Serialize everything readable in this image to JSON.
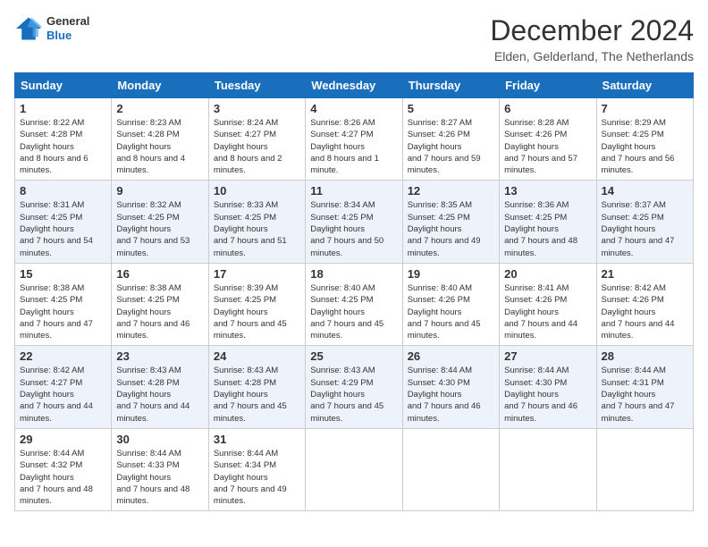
{
  "header": {
    "logo_general": "General",
    "logo_blue": "Blue",
    "title": "December 2024",
    "location": "Elden, Gelderland, The Netherlands"
  },
  "weekdays": [
    "Sunday",
    "Monday",
    "Tuesday",
    "Wednesday",
    "Thursday",
    "Friday",
    "Saturday"
  ],
  "weeks": [
    [
      {
        "day": "1",
        "sunrise": "8:22 AM",
        "sunset": "4:28 PM",
        "daylight": "8 hours and 6 minutes."
      },
      {
        "day": "2",
        "sunrise": "8:23 AM",
        "sunset": "4:28 PM",
        "daylight": "8 hours and 4 minutes."
      },
      {
        "day": "3",
        "sunrise": "8:24 AM",
        "sunset": "4:27 PM",
        "daylight": "8 hours and 2 minutes."
      },
      {
        "day": "4",
        "sunrise": "8:26 AM",
        "sunset": "4:27 PM",
        "daylight": "8 hours and 1 minute."
      },
      {
        "day": "5",
        "sunrise": "8:27 AM",
        "sunset": "4:26 PM",
        "daylight": "7 hours and 59 minutes."
      },
      {
        "day": "6",
        "sunrise": "8:28 AM",
        "sunset": "4:26 PM",
        "daylight": "7 hours and 57 minutes."
      },
      {
        "day": "7",
        "sunrise": "8:29 AM",
        "sunset": "4:25 PM",
        "daylight": "7 hours and 56 minutes."
      }
    ],
    [
      {
        "day": "8",
        "sunrise": "8:31 AM",
        "sunset": "4:25 PM",
        "daylight": "7 hours and 54 minutes."
      },
      {
        "day": "9",
        "sunrise": "8:32 AM",
        "sunset": "4:25 PM",
        "daylight": "7 hours and 53 minutes."
      },
      {
        "day": "10",
        "sunrise": "8:33 AM",
        "sunset": "4:25 PM",
        "daylight": "7 hours and 51 minutes."
      },
      {
        "day": "11",
        "sunrise": "8:34 AM",
        "sunset": "4:25 PM",
        "daylight": "7 hours and 50 minutes."
      },
      {
        "day": "12",
        "sunrise": "8:35 AM",
        "sunset": "4:25 PM",
        "daylight": "7 hours and 49 minutes."
      },
      {
        "day": "13",
        "sunrise": "8:36 AM",
        "sunset": "4:25 PM",
        "daylight": "7 hours and 48 minutes."
      },
      {
        "day": "14",
        "sunrise": "8:37 AM",
        "sunset": "4:25 PM",
        "daylight": "7 hours and 47 minutes."
      }
    ],
    [
      {
        "day": "15",
        "sunrise": "8:38 AM",
        "sunset": "4:25 PM",
        "daylight": "7 hours and 47 minutes."
      },
      {
        "day": "16",
        "sunrise": "8:38 AM",
        "sunset": "4:25 PM",
        "daylight": "7 hours and 46 minutes."
      },
      {
        "day": "17",
        "sunrise": "8:39 AM",
        "sunset": "4:25 PM",
        "daylight": "7 hours and 45 minutes."
      },
      {
        "day": "18",
        "sunrise": "8:40 AM",
        "sunset": "4:25 PM",
        "daylight": "7 hours and 45 minutes."
      },
      {
        "day": "19",
        "sunrise": "8:40 AM",
        "sunset": "4:26 PM",
        "daylight": "7 hours and 45 minutes."
      },
      {
        "day": "20",
        "sunrise": "8:41 AM",
        "sunset": "4:26 PM",
        "daylight": "7 hours and 44 minutes."
      },
      {
        "day": "21",
        "sunrise": "8:42 AM",
        "sunset": "4:26 PM",
        "daylight": "7 hours and 44 minutes."
      }
    ],
    [
      {
        "day": "22",
        "sunrise": "8:42 AM",
        "sunset": "4:27 PM",
        "daylight": "7 hours and 44 minutes."
      },
      {
        "day": "23",
        "sunrise": "8:43 AM",
        "sunset": "4:28 PM",
        "daylight": "7 hours and 44 minutes."
      },
      {
        "day": "24",
        "sunrise": "8:43 AM",
        "sunset": "4:28 PM",
        "daylight": "7 hours and 45 minutes."
      },
      {
        "day": "25",
        "sunrise": "8:43 AM",
        "sunset": "4:29 PM",
        "daylight": "7 hours and 45 minutes."
      },
      {
        "day": "26",
        "sunrise": "8:44 AM",
        "sunset": "4:30 PM",
        "daylight": "7 hours and 46 minutes."
      },
      {
        "day": "27",
        "sunrise": "8:44 AM",
        "sunset": "4:30 PM",
        "daylight": "7 hours and 46 minutes."
      },
      {
        "day": "28",
        "sunrise": "8:44 AM",
        "sunset": "4:31 PM",
        "daylight": "7 hours and 47 minutes."
      }
    ],
    [
      {
        "day": "29",
        "sunrise": "8:44 AM",
        "sunset": "4:32 PM",
        "daylight": "7 hours and 48 minutes."
      },
      {
        "day": "30",
        "sunrise": "8:44 AM",
        "sunset": "4:33 PM",
        "daylight": "7 hours and 48 minutes."
      },
      {
        "day": "31",
        "sunrise": "8:44 AM",
        "sunset": "4:34 PM",
        "daylight": "7 hours and 49 minutes."
      },
      null,
      null,
      null,
      null
    ]
  ]
}
